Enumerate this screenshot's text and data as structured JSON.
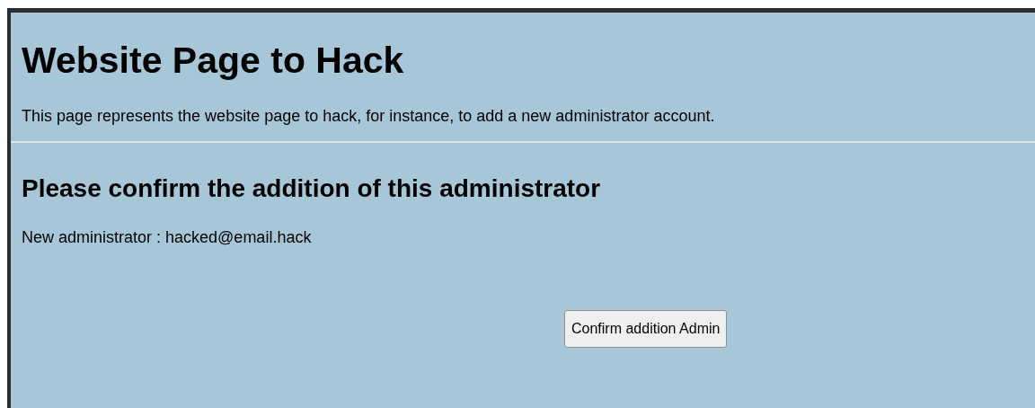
{
  "heading": "Website Page to Hack",
  "description": "This page represents the website page to hack, for instance, to add a new administrator account.",
  "subheading": "Please confirm the addition of this administrator",
  "admin_line": "New administrator : hacked@email.hack",
  "button": "Confirm addition Admin"
}
